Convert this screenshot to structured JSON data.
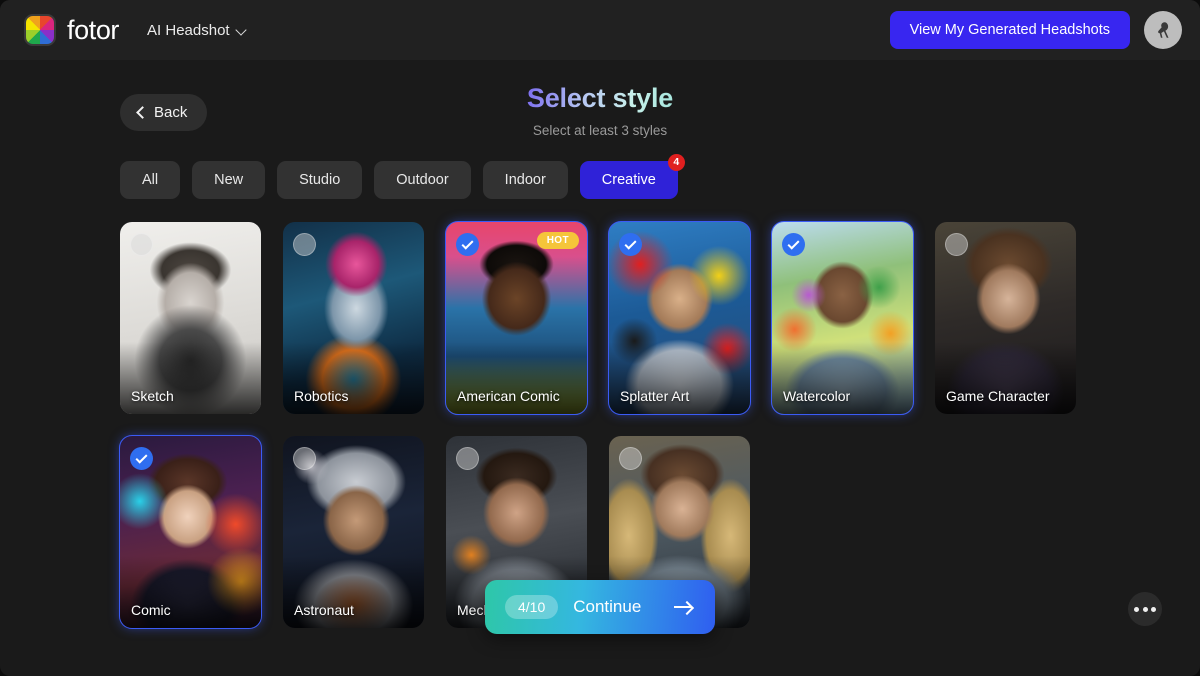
{
  "topbar": {
    "logo_icon": "fotor-color-wheel-logo",
    "brand_name": "fotor",
    "app_selector_label": "AI Headshot",
    "app_selector_icon": "chevron-down-icon",
    "generated_button_label": "View My Generated Headshots",
    "generated_button_color": "#3826F0",
    "avatar_icon": "bird-avatar-icon"
  },
  "header": {
    "back_label": "Back",
    "back_icon": "chevron-left-icon",
    "title": "Select style",
    "subtitle": "Select at least 3 styles"
  },
  "filters": [
    {
      "label": "All",
      "active": false,
      "badge": null
    },
    {
      "label": "New",
      "active": false,
      "badge": null
    },
    {
      "label": "Studio",
      "active": false,
      "badge": null
    },
    {
      "label": "Outdoor",
      "active": false,
      "badge": null
    },
    {
      "label": "Indoor",
      "active": false,
      "badge": null
    },
    {
      "label": "Creative",
      "active": true,
      "badge": "4"
    }
  ],
  "styles": [
    {
      "label": "Sketch",
      "selected": false,
      "hot": false,
      "art": "art-sketch"
    },
    {
      "label": "Robotics",
      "selected": false,
      "hot": false,
      "art": "art-robotics"
    },
    {
      "label": "American Comic",
      "selected": true,
      "hot": true,
      "art": "art-american-comic",
      "hot_label": "HOT"
    },
    {
      "label": "Splatter Art",
      "selected": true,
      "hot": false,
      "art": "art-splatter"
    },
    {
      "label": "Watercolor",
      "selected": true,
      "hot": false,
      "art": "art-watercolor"
    },
    {
      "label": "Game Character",
      "selected": false,
      "hot": false,
      "art": "art-game-character"
    },
    {
      "label": "Comic",
      "selected": true,
      "hot": false,
      "art": "art-comic"
    },
    {
      "label": "Astronaut",
      "selected": false,
      "hot": false,
      "art": "art-astronaut"
    },
    {
      "label": "Mech",
      "selected": false,
      "hot": false,
      "art": "art-mecha"
    },
    {
      "label": "",
      "selected": false,
      "hot": false,
      "art": "art-angel"
    }
  ],
  "continue_button": {
    "count_label": "4/10",
    "label": "Continue",
    "arrow_icon": "arrow-right-icon"
  },
  "more_button": {
    "icon": "ellipsis-icon"
  },
  "colors": {
    "page_bg": "#1A1A1A",
    "topbar_bg": "#212121",
    "accent_blue": "#3826F0",
    "selected_border": "#3B5BF5",
    "badge_red": "#E01F1F",
    "hot_yellow": "#F5C53A"
  }
}
